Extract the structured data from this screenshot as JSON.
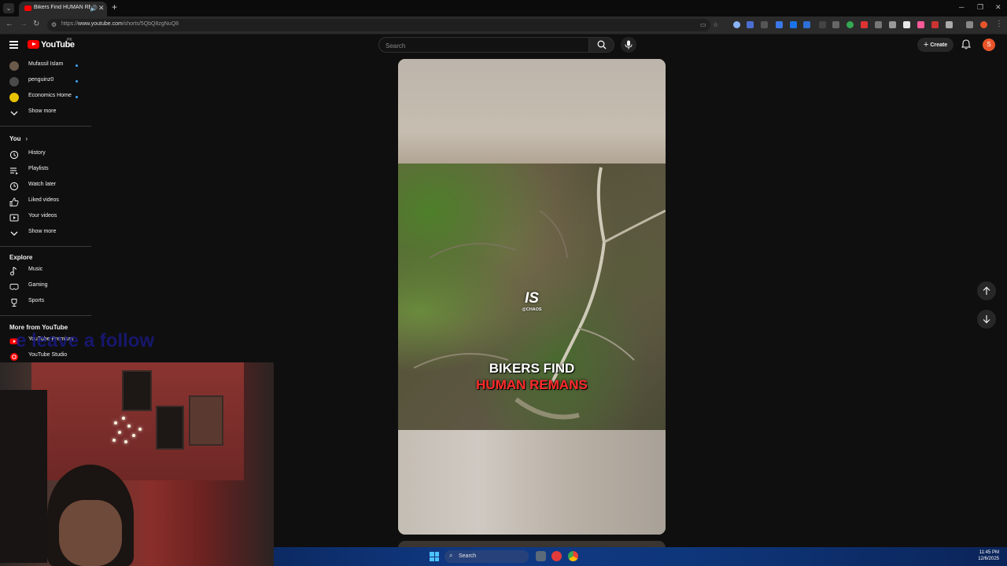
{
  "browser": {
    "tab_title": "Bikers Find HUMAN REMAINS",
    "url_prefix": "https://",
    "url_host": "www.youtube.com",
    "url_path": "/shorts/5QbQ8zgNuQ8",
    "new_tab_label": "+",
    "accent_color": "#ff0000"
  },
  "youtube": {
    "logo_text": "YouTube",
    "country_code": "PK",
    "search_placeholder": "Search",
    "create_label": "Create",
    "avatar_letter": "S"
  },
  "sidebar": {
    "subscriptions": [
      {
        "name": "Mufassil Islam"
      },
      {
        "name": "penguinz0"
      },
      {
        "name": "Economics Home"
      }
    ],
    "show_more_1": "Show more",
    "you_header": "You",
    "you_items": [
      {
        "label": "History",
        "icon": "history-icon"
      },
      {
        "label": "Playlists",
        "icon": "playlists-icon"
      },
      {
        "label": "Watch later",
        "icon": "watch-later-icon"
      },
      {
        "label": "Liked videos",
        "icon": "liked-videos-icon"
      },
      {
        "label": "Your videos",
        "icon": "your-videos-icon"
      }
    ],
    "show_more_2": "Show more",
    "explore_header": "Explore",
    "explore_items": [
      {
        "label": "Music",
        "icon": "music-icon"
      },
      {
        "label": "Gaming",
        "icon": "gaming-icon"
      },
      {
        "label": "Sports",
        "icon": "sports-icon"
      }
    ],
    "more_header": "More from YouTube",
    "more_items": [
      {
        "label": "YouTube Premium",
        "icon": "youtube-premium-icon"
      },
      {
        "label": "YouTube Studio",
        "icon": "youtube-studio-icon"
      }
    ]
  },
  "short": {
    "caption_line1": "BIKERS FIND",
    "caption_line2": "HUMAN REMANS",
    "watermark_logo": "IS",
    "watermark_handle": "@CHAOS"
  },
  "overlay": {
    "text": "e leave a follow"
  },
  "taskbar": {
    "search_label": "Search",
    "time": "11:45 PM",
    "date": "12/6/2025"
  }
}
